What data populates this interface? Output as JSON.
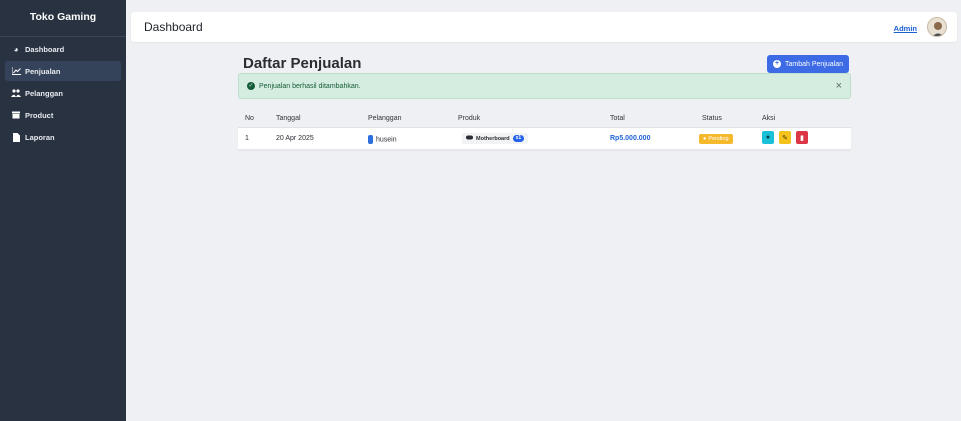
{
  "sidebar": {
    "brand": "Toko Gaming",
    "items": [
      {
        "label": "Dashboard",
        "icon": "dashboard-icon",
        "active": false
      },
      {
        "label": "Penjualan",
        "icon": "chart-line-icon",
        "active": true
      },
      {
        "label": "Pelanggan",
        "icon": "users-icon",
        "active": false
      },
      {
        "label": "Product",
        "icon": "box-icon",
        "active": false
      },
      {
        "label": "Laporan",
        "icon": "file-icon",
        "active": false
      }
    ]
  },
  "topbar": {
    "title": "Dashboard",
    "user": "Admin"
  },
  "page": {
    "title": "Daftar Penjualan",
    "add_button": "Tambah Penjualan",
    "alert": "Penjualan berhasil ditambahkan.",
    "alert_close": "×"
  },
  "table": {
    "headers": [
      "No",
      "Tanggal",
      "Pelanggan",
      "Produk",
      "Total",
      "Status",
      "Aksi"
    ],
    "rows": [
      {
        "no": "1",
        "tanggal": "20 Apr 2025",
        "pelanggan": "husein",
        "produk": "Motherboard",
        "produk_qty": "x1",
        "total": "Rp5.000.000",
        "status": "Pending"
      }
    ]
  },
  "colors": {
    "sidebar_bg": "#283241",
    "primary": "#3d6be6",
    "success_bg": "#d5ece1",
    "warning": "#f5b92d",
    "info": "#19c0d8",
    "danger": "#dc3545"
  }
}
